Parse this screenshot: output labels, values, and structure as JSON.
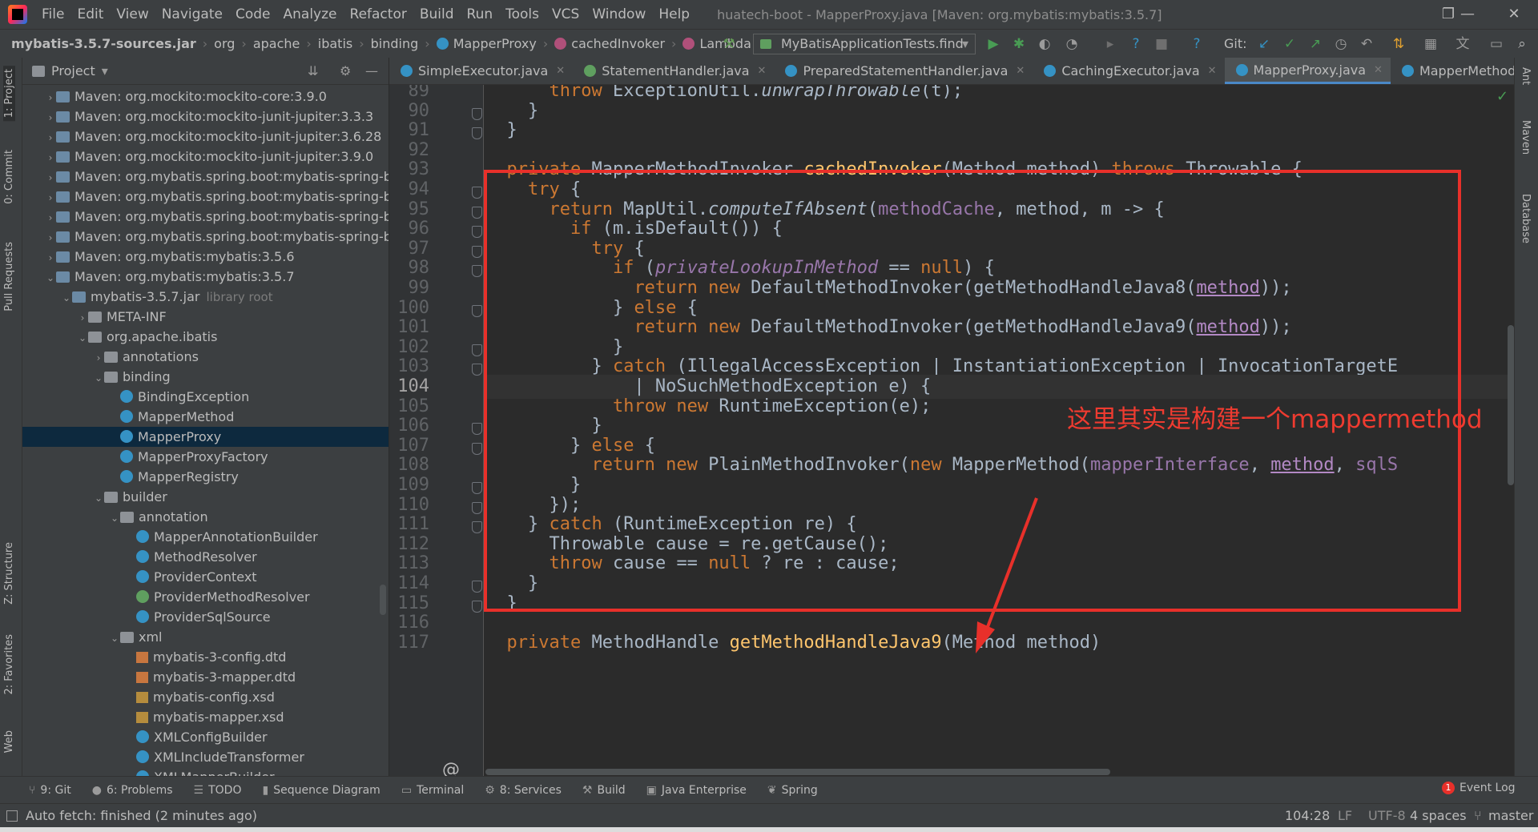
{
  "menu": {
    "items": [
      "File",
      "Edit",
      "View",
      "Navigate",
      "Code",
      "Analyze",
      "Refactor",
      "Build",
      "Run",
      "Tools",
      "VCS",
      "Window",
      "Help"
    ],
    "title": "huatech-boot - MapperProxy.java [Maven: org.mybatis:mybatis:3.5.7]",
    "minimize": "—",
    "maximize": "❐",
    "close": "✕"
  },
  "breadcrumb": {
    "items": [
      "mybatis-3.5.7-sources.jar",
      "org",
      "apache",
      "ibatis",
      "binding",
      "MapperProxy",
      "cachedInvoker",
      "Lambda"
    ],
    "run_config": "MyBatisApplicationTests.find",
    "git_label": "Git:"
  },
  "left_stripe": {
    "project": "1: Project",
    "commit": "0: Commit",
    "pull": "Pull Requests",
    "structure": "Z: Structure",
    "favorites": "2: Favorites",
    "web": "Web"
  },
  "right_stripe": {
    "ant": "Ant",
    "maven": "Maven",
    "database": "Database"
  },
  "project": {
    "title": "Project",
    "rows": [
      {
        "indent": 1,
        "arrow": "›",
        "icon": "lib",
        "label": "Maven: org.mockito:mockito-core:3.9.0"
      },
      {
        "indent": 1,
        "arrow": "›",
        "icon": "lib",
        "label": "Maven: org.mockito:mockito-junit-jupiter:3.3.3"
      },
      {
        "indent": 1,
        "arrow": "›",
        "icon": "lib",
        "label": "Maven: org.mockito:mockito-junit-jupiter:3.6.28"
      },
      {
        "indent": 1,
        "arrow": "›",
        "icon": "lib",
        "label": "Maven: org.mockito:mockito-junit-jupiter:3.9.0"
      },
      {
        "indent": 1,
        "arrow": "›",
        "icon": "lib",
        "label": "Maven: org.mybatis.spring.boot:mybatis-spring-boo"
      },
      {
        "indent": 1,
        "arrow": "›",
        "icon": "lib",
        "label": "Maven: org.mybatis.spring.boot:mybatis-spring-boo"
      },
      {
        "indent": 1,
        "arrow": "›",
        "icon": "lib",
        "label": "Maven: org.mybatis.spring.boot:mybatis-spring-boo"
      },
      {
        "indent": 1,
        "arrow": "›",
        "icon": "lib",
        "label": "Maven: org.mybatis.spring.boot:mybatis-spring-boo"
      },
      {
        "indent": 1,
        "arrow": "›",
        "icon": "lib",
        "label": "Maven: org.mybatis:mybatis:3.5.6"
      },
      {
        "indent": 1,
        "arrow": "⌄",
        "icon": "lib",
        "label": "Maven: org.mybatis:mybatis:3.5.7"
      },
      {
        "indent": 2,
        "arrow": "⌄",
        "icon": "lib",
        "label": "mybatis-3.5.7.jar",
        "note": "library root"
      },
      {
        "indent": 3,
        "arrow": "›",
        "icon": "folder",
        "label": "META-INF"
      },
      {
        "indent": 3,
        "arrow": "⌄",
        "icon": "folder",
        "label": "org.apache.ibatis"
      },
      {
        "indent": 4,
        "arrow": "›",
        "icon": "folder",
        "label": "annotations"
      },
      {
        "indent": 4,
        "arrow": "⌄",
        "icon": "folder",
        "label": "binding"
      },
      {
        "indent": 5,
        "arrow": "",
        "icon": "cls",
        "label": "BindingException"
      },
      {
        "indent": 5,
        "arrow": "",
        "icon": "cls",
        "label": "MapperMethod"
      },
      {
        "indent": 5,
        "arrow": "",
        "icon": "cls",
        "label": "MapperProxy",
        "selected": true
      },
      {
        "indent": 5,
        "arrow": "",
        "icon": "cls",
        "label": "MapperProxyFactory"
      },
      {
        "indent": 5,
        "arrow": "",
        "icon": "cls",
        "label": "MapperRegistry"
      },
      {
        "indent": 4,
        "arrow": "⌄",
        "icon": "folder",
        "label": "builder"
      },
      {
        "indent": 5,
        "arrow": "⌄",
        "icon": "folder",
        "label": "annotation"
      },
      {
        "indent": 6,
        "arrow": "",
        "icon": "cls",
        "label": "MapperAnnotationBuilder"
      },
      {
        "indent": 6,
        "arrow": "",
        "icon": "cls",
        "label": "MethodResolver"
      },
      {
        "indent": 6,
        "arrow": "",
        "icon": "cls",
        "label": "ProviderContext"
      },
      {
        "indent": 6,
        "arrow": "",
        "icon": "intf",
        "label": "ProviderMethodResolver"
      },
      {
        "indent": 6,
        "arrow": "",
        "icon": "cls",
        "label": "ProviderSqlSource"
      },
      {
        "indent": 5,
        "arrow": "⌄",
        "icon": "folder",
        "label": "xml"
      },
      {
        "indent": 6,
        "arrow": "",
        "icon": "dtd",
        "label": "mybatis-3-config.dtd"
      },
      {
        "indent": 6,
        "arrow": "",
        "icon": "dtd",
        "label": "mybatis-3-mapper.dtd"
      },
      {
        "indent": 6,
        "arrow": "",
        "icon": "xsd",
        "label": "mybatis-config.xsd"
      },
      {
        "indent": 6,
        "arrow": "",
        "icon": "xsd",
        "label": "mybatis-mapper.xsd"
      },
      {
        "indent": 6,
        "arrow": "",
        "icon": "cls",
        "label": "XMLConfigBuilder"
      },
      {
        "indent": 6,
        "arrow": "",
        "icon": "cls",
        "label": "XMLIncludeTransformer"
      },
      {
        "indent": 6,
        "arrow": "",
        "icon": "cls",
        "label": "XMLMapperBuilder"
      }
    ]
  },
  "tabs": [
    {
      "label": "SimpleExecutor.java",
      "icon": "c"
    },
    {
      "label": "StatementHandler.java",
      "icon": "i"
    },
    {
      "label": "PreparedStatementHandler.java",
      "icon": "c"
    },
    {
      "label": "CachingExecutor.java",
      "icon": "c"
    },
    {
      "label": "MapperProxy.java",
      "icon": "c",
      "active": true
    },
    {
      "label": "MapperMethod.java",
      "icon": "c"
    }
  ],
  "editor": {
    "current_line": 104,
    "lines": [
      {
        "n": 89,
        "tokens": [
          [
            "      ",
            ""
          ],
          [
            "throw ",
            "kw"
          ],
          [
            "ExceptionUtil.",
            ""
          ],
          [
            "unwrapThrowable",
            "it"
          ],
          [
            "(t);",
            ""
          ]
        ]
      },
      {
        "n": 90,
        "tokens": [
          [
            "    }",
            ""
          ]
        ]
      },
      {
        "n": 91,
        "tokens": [
          [
            "  }",
            ""
          ]
        ]
      },
      {
        "n": 92,
        "tokens": []
      },
      {
        "n": 93,
        "tokens": [
          [
            "  ",
            ""
          ],
          [
            "private ",
            "kw"
          ],
          [
            "MapperMethodInvoker ",
            ""
          ],
          [
            "cachedInvoker",
            "fn"
          ],
          [
            "(Method method) ",
            ""
          ],
          [
            "throws ",
            "kw"
          ],
          [
            "Throwable {",
            ""
          ]
        ]
      },
      {
        "n": 94,
        "tokens": [
          [
            "    ",
            ""
          ],
          [
            "try ",
            "kw"
          ],
          [
            "{",
            ""
          ]
        ]
      },
      {
        "n": 95,
        "tokens": [
          [
            "      ",
            ""
          ],
          [
            "return ",
            "kw"
          ],
          [
            "MapUtil.",
            ""
          ],
          [
            "computeIfAbsent",
            "it"
          ],
          [
            "(",
            ""
          ],
          [
            "methodCache",
            "fld"
          ],
          [
            ", method, m -> {",
            ""
          ]
        ]
      },
      {
        "n": 96,
        "tokens": [
          [
            "        ",
            ""
          ],
          [
            "if ",
            "kw"
          ],
          [
            "(m.isDefault()) {",
            ""
          ]
        ]
      },
      {
        "n": 97,
        "tokens": [
          [
            "          ",
            ""
          ],
          [
            "try ",
            "kw"
          ],
          [
            "{",
            ""
          ]
        ]
      },
      {
        "n": 98,
        "tokens": [
          [
            "            ",
            ""
          ],
          [
            "if ",
            "kw"
          ],
          [
            "(",
            ""
          ],
          [
            "privateLookupInMethod",
            "fld it"
          ],
          [
            " == ",
            ""
          ],
          [
            "null",
            "kw"
          ],
          [
            ") {",
            ""
          ]
        ]
      },
      {
        "n": 99,
        "tokens": [
          [
            "              ",
            ""
          ],
          [
            "return new ",
            "kw"
          ],
          [
            "DefaultMethodInvoker(getMethodHandleJava8(",
            ""
          ],
          [
            "method",
            "ul"
          ],
          [
            "));",
            ""
          ]
        ]
      },
      {
        "n": 100,
        "tokens": [
          [
            "            } ",
            ""
          ],
          [
            "else ",
            "kw"
          ],
          [
            "{",
            ""
          ]
        ]
      },
      {
        "n": 101,
        "tokens": [
          [
            "              ",
            ""
          ],
          [
            "return new ",
            "kw"
          ],
          [
            "DefaultMethodInvoker(getMethodHandleJava9(",
            ""
          ],
          [
            "method",
            "ul"
          ],
          [
            "));",
            ""
          ]
        ]
      },
      {
        "n": 102,
        "tokens": [
          [
            "            }",
            ""
          ]
        ]
      },
      {
        "n": 103,
        "tokens": [
          [
            "          } ",
            ""
          ],
          [
            "catch ",
            "kw"
          ],
          [
            "(IllegalAccessException | InstantiationException | InvocationTargetE",
            ""
          ]
        ]
      },
      {
        "n": 104,
        "tokens": [
          [
            "              | NoSuchMethodException e) {",
            ""
          ]
        ]
      },
      {
        "n": 105,
        "tokens": [
          [
            "            ",
            ""
          ],
          [
            "throw new ",
            "kw"
          ],
          [
            "RuntimeException(e);",
            ""
          ]
        ]
      },
      {
        "n": 106,
        "tokens": [
          [
            "          }",
            ""
          ]
        ]
      },
      {
        "n": 107,
        "tokens": [
          [
            "        } ",
            ""
          ],
          [
            "else ",
            "kw"
          ],
          [
            "{",
            ""
          ]
        ]
      },
      {
        "n": 108,
        "tokens": [
          [
            "          ",
            ""
          ],
          [
            "return new ",
            "kw"
          ],
          [
            "PlainMethodInvoker(",
            ""
          ],
          [
            "new ",
            "kw"
          ],
          [
            "MapperMethod(",
            ""
          ],
          [
            "mapperInterface",
            "fld"
          ],
          [
            ", ",
            ""
          ],
          [
            "method",
            "ul"
          ],
          [
            ", ",
            ""
          ],
          [
            "sqlS",
            "fld"
          ]
        ]
      },
      {
        "n": 109,
        "tokens": [
          [
            "        }",
            ""
          ]
        ]
      },
      {
        "n": 110,
        "tokens": [
          [
            "      });",
            ""
          ]
        ]
      },
      {
        "n": 111,
        "tokens": [
          [
            "    } ",
            ""
          ],
          [
            "catch ",
            "kw"
          ],
          [
            "(RuntimeException re) {",
            ""
          ]
        ]
      },
      {
        "n": 112,
        "tokens": [
          [
            "      Throwable cause = re.getCause();",
            ""
          ]
        ]
      },
      {
        "n": 113,
        "tokens": [
          [
            "      ",
            ""
          ],
          [
            "throw ",
            "kw"
          ],
          [
            "cause == ",
            ""
          ],
          [
            "null ",
            "kw"
          ],
          [
            "? re : cause;",
            ""
          ]
        ]
      },
      {
        "n": 114,
        "tokens": [
          [
            "    }",
            ""
          ]
        ]
      },
      {
        "n": 115,
        "tokens": [
          [
            "  }",
            ""
          ]
        ]
      },
      {
        "n": 116,
        "tokens": []
      },
      {
        "n": 117,
        "tokens": [
          [
            "  ",
            ""
          ],
          [
            "private ",
            "kw"
          ],
          [
            "MethodHandle ",
            ""
          ],
          [
            "getMethodHandleJava9",
            "fn"
          ],
          [
            "(Method method)",
            ""
          ]
        ]
      }
    ],
    "annotation": "这里其实是构建一个mappermethod",
    "at_marker": "@",
    "check_mark": "✓"
  },
  "bottom_tabs": [
    {
      "label": "9: Git",
      "icon": "⑂"
    },
    {
      "label": "6: Problems",
      "icon": "●"
    },
    {
      "label": "TODO",
      "icon": "☰"
    },
    {
      "label": "Sequence Diagram",
      "icon": "▮"
    },
    {
      "label": "Terminal",
      "icon": "▭"
    },
    {
      "label": "8: Services",
      "icon": "⚙"
    },
    {
      "label": "Build",
      "icon": "⚒"
    },
    {
      "label": "Java Enterprise",
      "icon": "▣"
    },
    {
      "label": "Spring",
      "icon": "❦"
    }
  ],
  "event_log": {
    "label": "Event Log",
    "count": "1"
  },
  "status": {
    "message": "Auto fetch: finished (2 minutes ago)",
    "position": "104:28",
    "line_sep": "LF",
    "encoding": "UTF-8",
    "indent": "4 spaces",
    "branch": "master"
  },
  "colors": {
    "accent": "#4a88c7",
    "annotation": "#e8302a",
    "keyword": "#cc7832",
    "function": "#ffc66d",
    "field": "#9876aa"
  }
}
